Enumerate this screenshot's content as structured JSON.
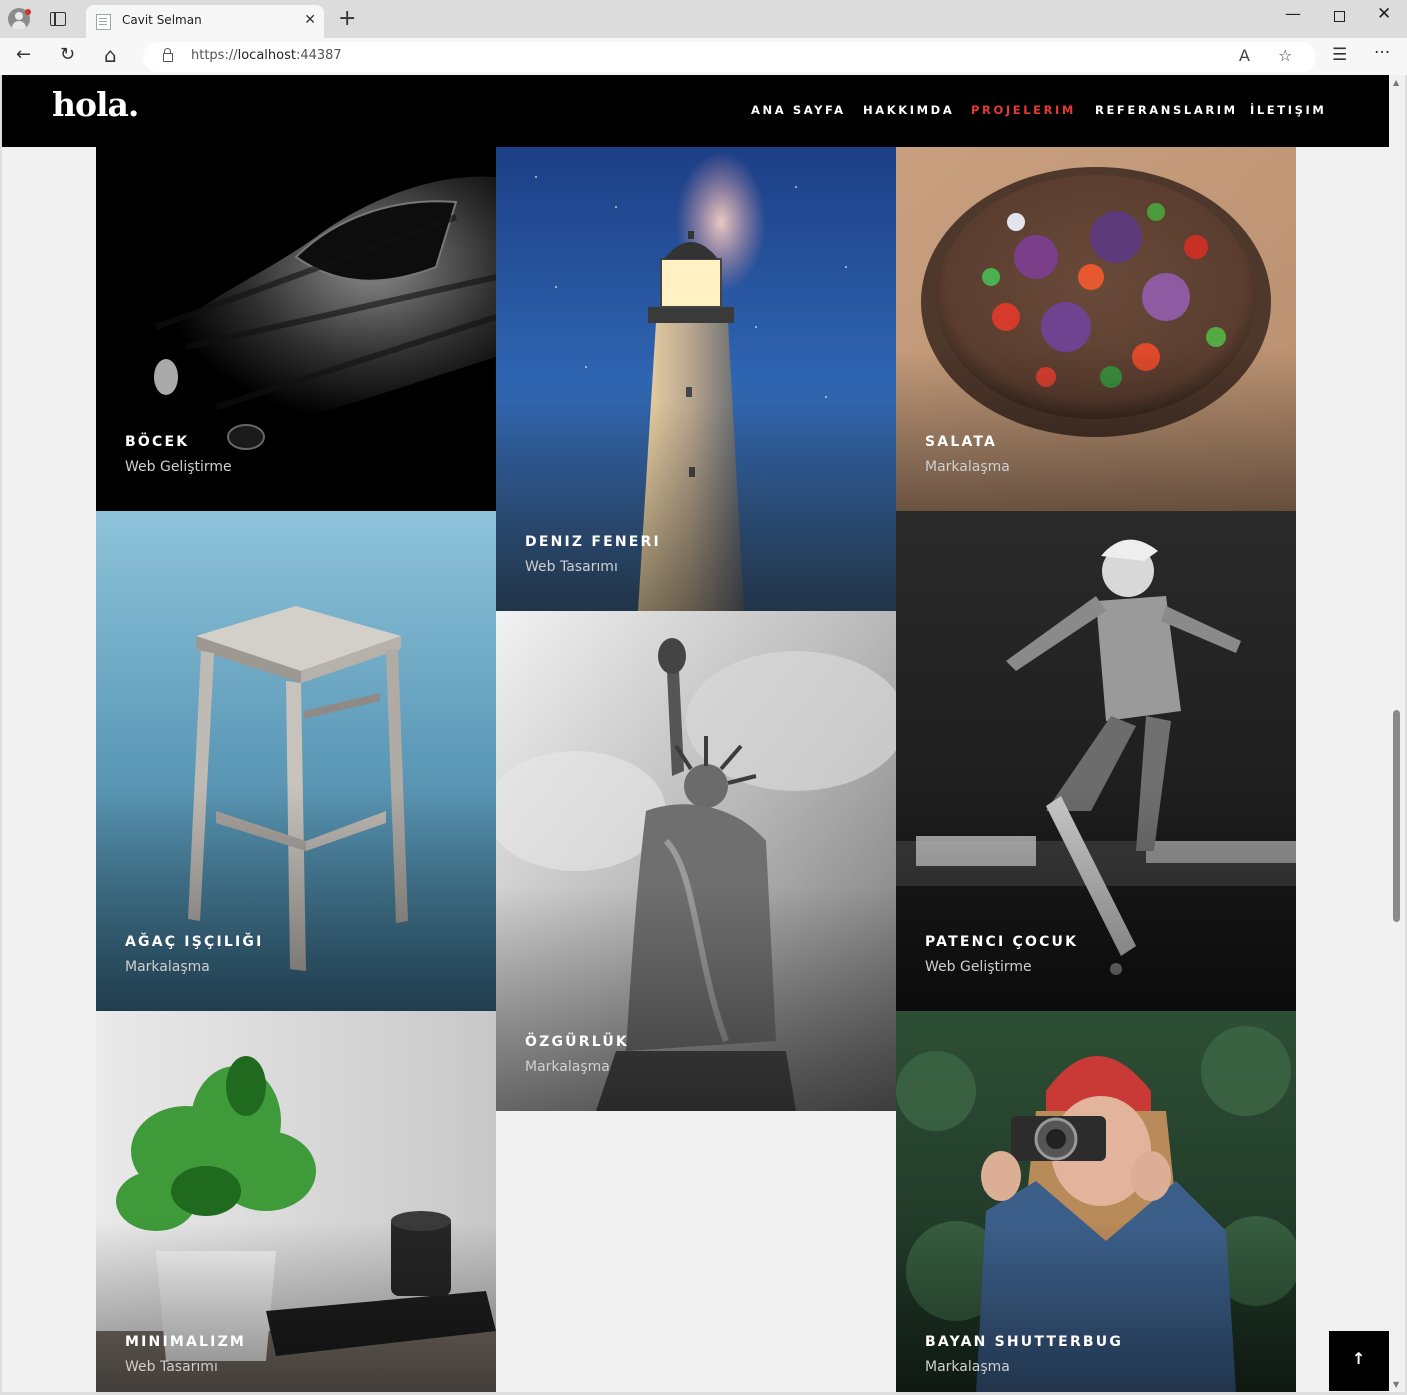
{
  "browser": {
    "tab_title": "Cavit Selman",
    "tab_close": "✕",
    "new_tab": "+",
    "url_scheme": "https://",
    "url_host": "localhost",
    "url_port": ":44387",
    "window_min": "—",
    "window_close": "✕",
    "back": "←",
    "reload": "↻",
    "home": "⌂",
    "read_aloud": "A",
    "favorite": "☆",
    "favorites_bar": "☰",
    "more": "···"
  },
  "site": {
    "logo": "hola.",
    "menu": [
      {
        "label": "ANA SAYFA",
        "active": false
      },
      {
        "label": "HAKKIMDA",
        "active": false
      },
      {
        "label": "PROJELERIM",
        "active": true
      },
      {
        "label": "REFERANSLARIM",
        "active": false
      },
      {
        "label": "İLETIŞIM",
        "active": false
      }
    ],
    "accent_color": "#e53935",
    "back_to_top": "↑"
  },
  "projects": [
    {
      "title": "BÖCEK",
      "category": "Web Geliştirme"
    },
    {
      "title": "DENIZ FENERI",
      "category": "Web Tasarımı"
    },
    {
      "title": "SALATA",
      "category": "Markalaşma"
    },
    {
      "title": "AĞAÇ IŞÇILIĞI",
      "category": "Markalaşma"
    },
    {
      "title": "PATENCI ÇOCUK",
      "category": "Web Geliştirme"
    },
    {
      "title": "ÖZGÜRLÜK",
      "category": "Markalaşma"
    },
    {
      "title": "MINIMALIZM",
      "category": "Web Tasarımı"
    },
    {
      "title": "BAYAN SHUTTERBUG",
      "category": "Markalaşma"
    }
  ]
}
